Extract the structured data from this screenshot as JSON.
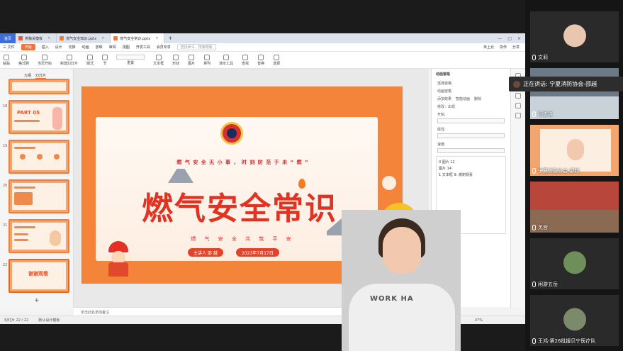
{
  "browser_tabs": {
    "home": "首页",
    "tab1": "供稿关模板",
    "tab2": "燃气安全知识.pptx",
    "tab3": "燃气安全常识.pptx"
  },
  "menu": {
    "file": "三 文件",
    "items": [
      "开始",
      "插入",
      "设计",
      "切换",
      "动画",
      "放映",
      "审阅",
      "视图",
      "开发工具",
      "会员专享"
    ],
    "search_placeholder": "查找命令、搜索模板",
    "right": [
      "未上云",
      "协作",
      "分享"
    ]
  },
  "ribbon": [
    "粘贴",
    "格式刷",
    "当页开始",
    "新建幻灯片",
    "版式",
    "节",
    "重置",
    "文本框",
    "形状",
    "图片",
    "排列",
    "演示工具",
    "查找",
    "替换",
    "选择"
  ],
  "thumb_tabs": {
    "outline": "大纲",
    "slides": "幻灯片"
  },
  "thumbs": [
    {
      "num": "18",
      "title": "PART 05"
    },
    {
      "num": "19",
      "title": ""
    },
    {
      "num": "20",
      "title": ""
    },
    {
      "num": "21",
      "title": ""
    },
    {
      "num": "22",
      "title": "谢谢观看"
    }
  ],
  "slide": {
    "slogan": "燃 气 安 全 无 小 事 ， 时 刻 防 范 于 未 “ 燃 ”",
    "title": "燃气安全常识",
    "subline": "燃 气 安 全   共 筑 平 安",
    "presenter": "主讲人   邵 越",
    "date": "2023年7月17日"
  },
  "notes": "单击此处添加备注",
  "status": {
    "slide_count": "幻灯片 22 / 22",
    "theme": "默认设计模板",
    "zoom": "47%"
  },
  "anim_pane": {
    "title": "动画窗格",
    "select_pane": "选择窗格",
    "add_effect": "动画窗格",
    "labels": [
      "添加效果",
      "智能动画",
      "删除",
      "修改：出现",
      "开始:",
      "属性:",
      "速度:"
    ],
    "items": [
      "0  图片 12",
      "   图片 14",
      "1  文本框 9: 谢谢观看"
    ]
  },
  "speaker_shirt": "WORK HA",
  "meeting": {
    "talking_label": "正在讲话: 宁夏消防协会-邵越",
    "participants": [
      {
        "name": "文莉"
      },
      {
        "name": "杨志连"
      },
      {
        "name": "宁夏消防协会-邵越"
      },
      {
        "name": "芙蓉"
      },
      {
        "name": "闲游五岳"
      },
      {
        "name": "王鸿-第26批援贝宁医疗队"
      }
    ]
  }
}
